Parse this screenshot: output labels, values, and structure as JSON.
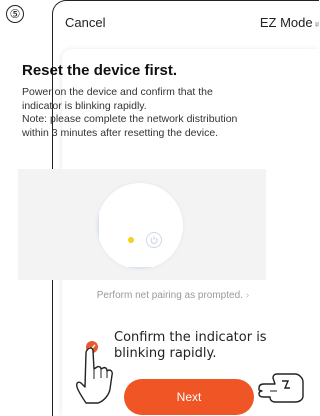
{
  "step": {
    "marker": "⑤"
  },
  "topbar": {
    "cancel_label": "Cancel",
    "mode_label": "EZ Mode"
  },
  "main": {
    "title": "Reset the device first.",
    "description_lines": [
      "Power on the device and confirm that the indicator is blinking rapidly.",
      "Note: please complete the network distribution within 3 minutes after resetting the device."
    ],
    "prompt_link": "Perform net pairing as prompted.",
    "confirm_label": "Confirm the indicator is blinking rapidly.",
    "confirm_checked": true,
    "next_label": "Next"
  },
  "colors": {
    "accent": "#EF5525",
    "indicator_led": "#F5D31A",
    "illustration_bg": "#F3F3F4"
  },
  "icons": [
    "power-icon",
    "check-icon",
    "chevron-right-icon",
    "pointing-hand-icon",
    "pointing-hand-right-icon"
  ]
}
